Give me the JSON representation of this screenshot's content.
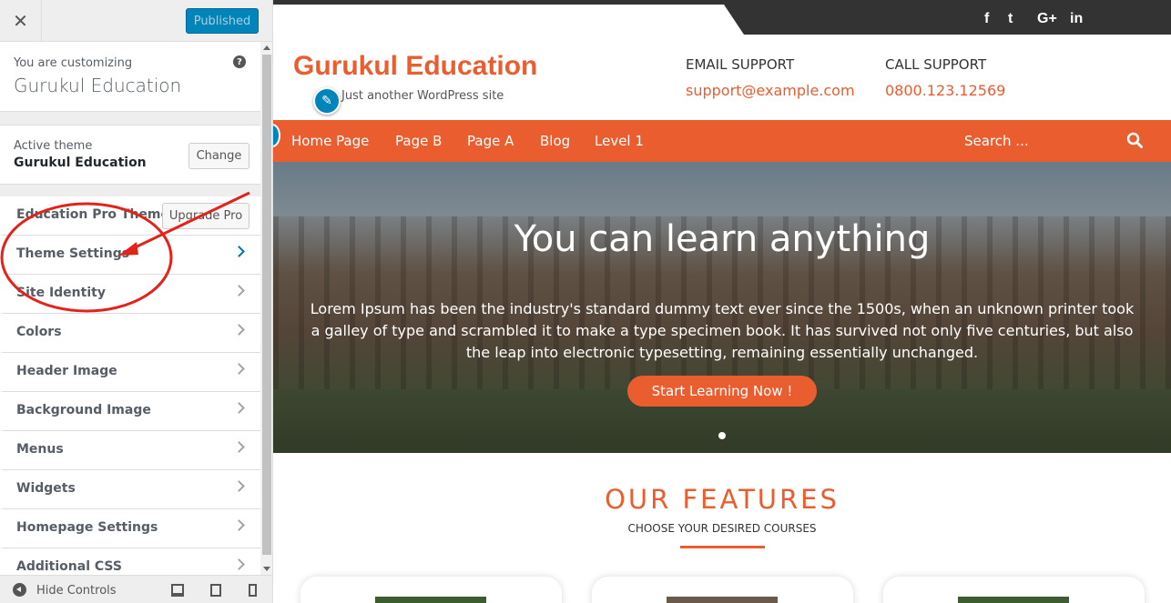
{
  "sidebar": {
    "close_icon": "close-icon",
    "publish_label": "Published",
    "customizing_label": "You are customizing",
    "site_name": "Gurukul Education",
    "help_icon": "?",
    "active_theme_label": "Active theme",
    "active_theme_name": "Gurukul Education",
    "change_label": "Change",
    "pro_section": {
      "label": "Education Pro Theme",
      "button": "Upgrade Pro"
    },
    "sections": [
      "Theme Settings",
      "Site Identity",
      "Colors",
      "Header Image",
      "Background Image",
      "Menus",
      "Widgets",
      "Homepage Settings",
      "Additional CSS"
    ],
    "footer": {
      "hide_label": "Hide Controls"
    }
  },
  "preview": {
    "social": [
      "f",
      "t",
      "G+",
      "in"
    ],
    "site_title": "Gurukul Education",
    "tagline": "Just another WordPress site",
    "email_heading": "EMAIL SUPPORT",
    "email_value": "support@example.com",
    "call_heading": "CALL SUPPORT",
    "call_value": "0800.123.12569",
    "nav": [
      "Home Page",
      "Page B",
      "Page A",
      "Blog",
      "Level 1"
    ],
    "search_placeholder": "Search ...",
    "hero_title": "You can learn anything",
    "hero_text": "Lorem Ipsum has been the industry's standard dummy text ever since the 1500s, when an unknown printer took a galley of type and scrambled it to make a type specimen book. It has survived not only five centuries, but also the leap into electronic typesetting, remaining essentially unchanged.",
    "cta": "Start Learning Now !",
    "features_title": "OUR FEATURES",
    "features_subtitle": "CHOOSE YOUR DESIRED COURSES"
  },
  "colors": {
    "accent": "#e95d2f",
    "wp_blue": "#0085ba",
    "annotation_red": "#e2231a"
  }
}
